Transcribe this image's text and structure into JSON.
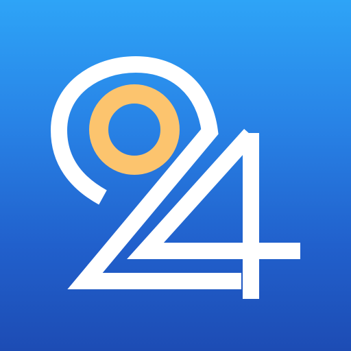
{
  "logo": {
    "description_colors": {
      "background_top": "#2ea4f7",
      "background_bottom": "#1d4cb4",
      "glyph": "#ffffff",
      "ring": "#fcc46e"
    }
  }
}
